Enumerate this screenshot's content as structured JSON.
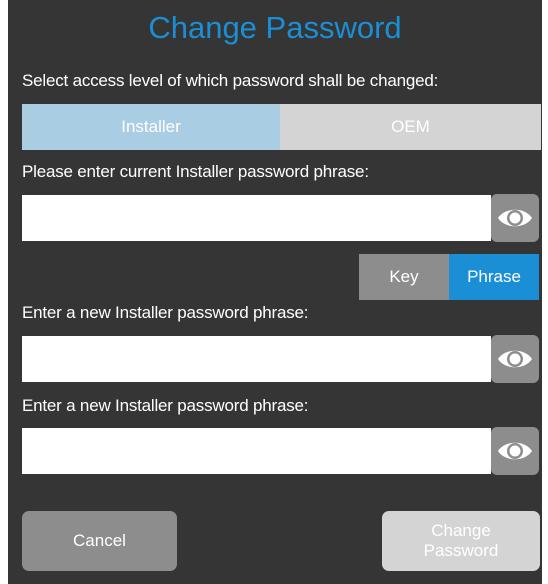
{
  "dialog": {
    "title": "Change Password",
    "access_level_prompt": "Select access level of which password shall be changed:",
    "access_levels": [
      {
        "label": "Installer",
        "selected": true
      },
      {
        "label": "OEM",
        "selected": false
      }
    ],
    "current_password_label": "Please enter current Installer password phrase:",
    "current_password_value": "",
    "input_mode_options": [
      {
        "label": "Key",
        "selected": false
      },
      {
        "label": "Phrase",
        "selected": true
      }
    ],
    "new_password_label": "Enter a new Installer password phrase:",
    "new_password_value": "",
    "confirm_password_label": "Enter a new Installer password phrase:",
    "confirm_password_value": "",
    "cancel_label": "Cancel",
    "change_label": "Change Password"
  },
  "icons": {
    "show_password": "eye-icon"
  },
  "colors": {
    "background": "#353535",
    "accent": "#1a8fd6",
    "selected_segment": "#a9cde3",
    "unselected_segment": "#d4d4d4",
    "button_gray": "#8d8d8d"
  }
}
